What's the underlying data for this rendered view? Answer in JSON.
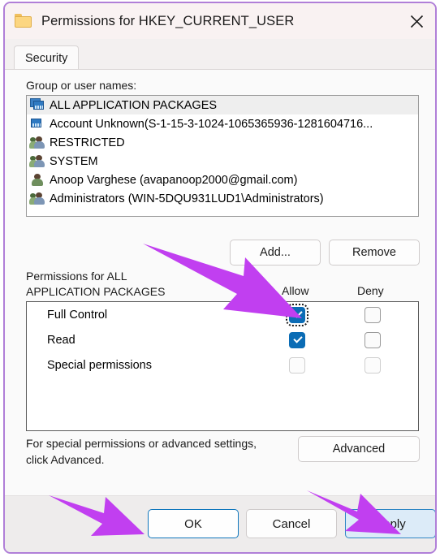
{
  "window": {
    "title": "Permissions for HKEY_CURRENT_USER",
    "folder_icon": "folder-icon",
    "close_icon": "close-icon",
    "border_color": "#b07fd8",
    "titlebar_color": "#f9f2f2"
  },
  "tabs": [
    {
      "label": "Security",
      "selected": true
    }
  ],
  "group_section": {
    "label": "Group or user names:",
    "items": [
      {
        "name": "ALL APPLICATION PACKAGES",
        "icon": "application-package-icon",
        "selected": true
      },
      {
        "name": "Account Unknown(S-1-15-3-1024-1065365936-1281604716...",
        "icon": "application-package-icon",
        "selected": false
      },
      {
        "name": "RESTRICTED",
        "icon": "group-icon",
        "selected": false
      },
      {
        "name": "SYSTEM",
        "icon": "group-icon",
        "selected": false
      },
      {
        "name": "Anoop Varghese (avapanoop2000@gmail.com)",
        "icon": "user-icon",
        "selected": false
      },
      {
        "name": "Administrators (WIN-5DQU931LUD1\\Administrators)",
        "icon": "group-icon",
        "selected": false
      }
    ]
  },
  "buttons": {
    "add": "Add...",
    "remove": "Remove",
    "advanced": "Advanced",
    "ok": "OK",
    "cancel": "Cancel",
    "apply": "Apply"
  },
  "permissions_section": {
    "label": "Permissions for ALL APPLICATION PACKAGES",
    "columns": {
      "allow": "Allow",
      "deny": "Deny"
    },
    "rows": [
      {
        "name": "Full Control",
        "allow": "checked",
        "deny": "unchecked",
        "allow_focused": true,
        "deny_disabled": false
      },
      {
        "name": "Read",
        "allow": "checked",
        "deny": "unchecked",
        "allow_focused": false,
        "deny_disabled": false
      },
      {
        "name": "Special permissions",
        "allow": "unchecked",
        "deny": "unchecked",
        "allow_focused": false,
        "deny_disabled": true
      }
    ]
  },
  "footnote": "For special permissions or advanced settings, click Advanced.",
  "annotations": {
    "arrow_color": "#c13ff0",
    "arrows": [
      {
        "name": "arrow-to-full-control-allow"
      },
      {
        "name": "arrow-to-ok-button"
      },
      {
        "name": "arrow-to-apply-button"
      }
    ]
  },
  "colors": {
    "checkbox_checked": "#0b6cb5",
    "focus_border": "#0f76bc",
    "apply_hover_fill": "#dcebf8"
  }
}
